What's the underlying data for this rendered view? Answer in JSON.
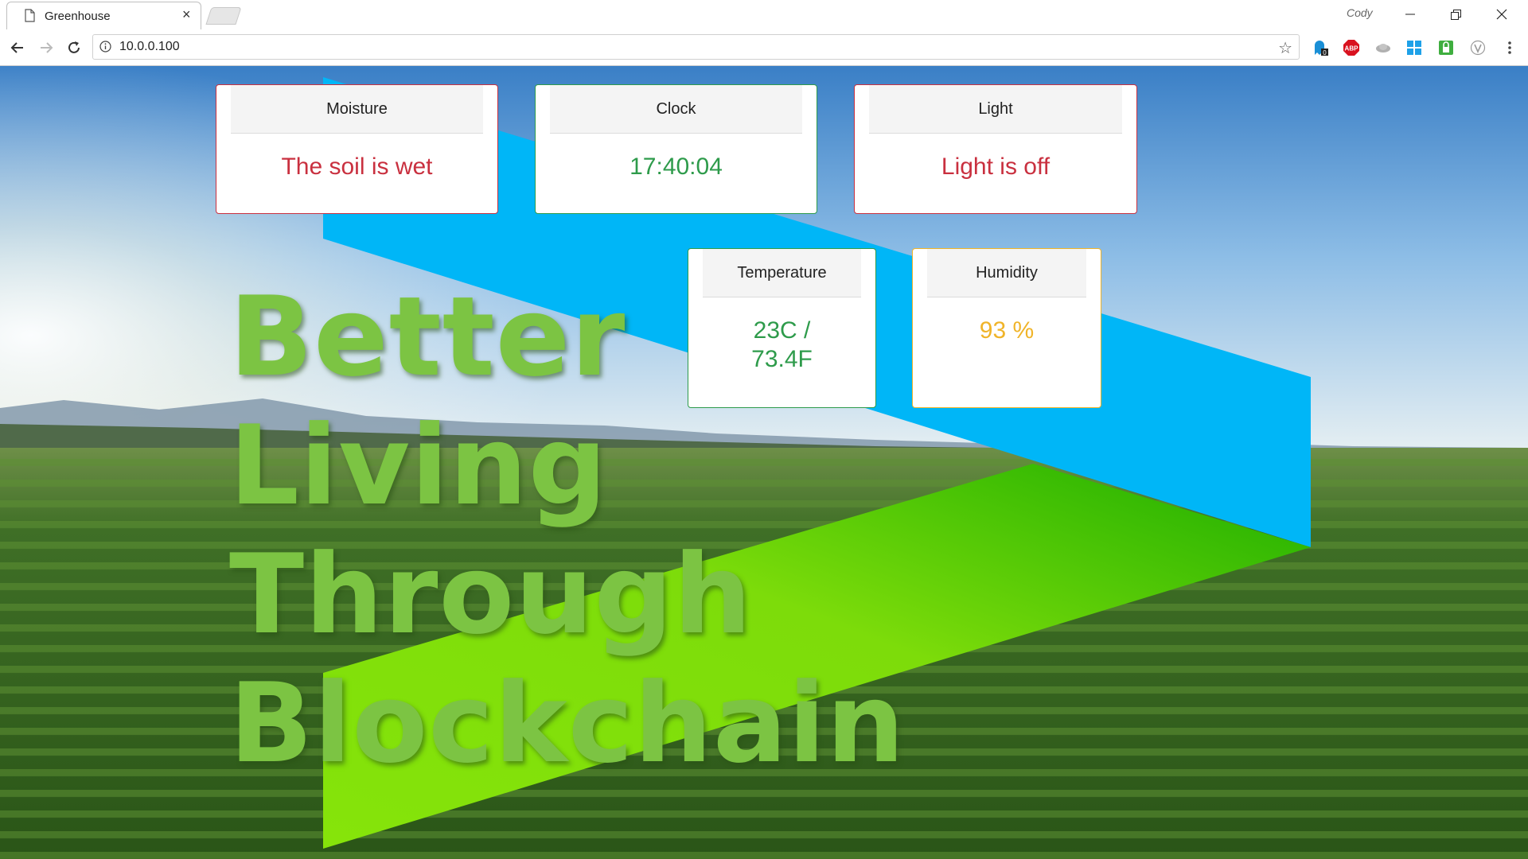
{
  "browser": {
    "tab_title": "Greenhouse",
    "tab_close": "×",
    "profile_name": "Cody",
    "url": "10.0.0.100",
    "extensions": [
      "ghostery-icon",
      "adblock-plus-icon",
      "extension-cloud-icon",
      "windows-icon",
      "lock-extension-icon",
      "v-extension-icon"
    ],
    "ghostery_badge": "0",
    "adblock_label": "ABP"
  },
  "cards": {
    "moisture": {
      "title": "Moisture",
      "value": "The soil is wet",
      "color": "#c9303f"
    },
    "clock": {
      "title": "Clock",
      "value": "17:40:04",
      "color": "#2e9b4b"
    },
    "light": {
      "title": "Light",
      "value": "Light is off",
      "color": "#c9303f"
    },
    "temperature": {
      "title": "Temperature",
      "value_line1": "23C /",
      "value_line2": "73.4F",
      "color": "#2e9b4b"
    },
    "humidity": {
      "title": "Humidity",
      "value": "93 %",
      "color": "#f0b429"
    }
  },
  "slogan": [
    "Better",
    "Living",
    "Through",
    "Blockchain"
  ],
  "colors": {
    "banner_blue": "#00b6f7",
    "banner_green": "#7ddc0a",
    "slogan_green": "#7cc443"
  }
}
